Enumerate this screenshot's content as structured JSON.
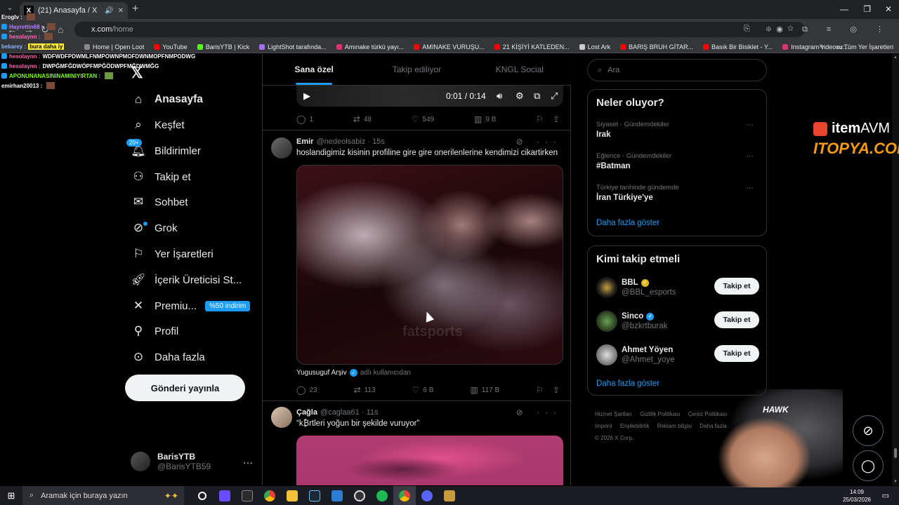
{
  "browser": {
    "tab_title": "(21) Anasayfa / X",
    "url_host": "x.com",
    "url_path": "/home",
    "bookmarks": [
      {
        "label": "Home | Open Loot",
        "color": "#8a8a8a"
      },
      {
        "label": "YouTube",
        "color": "#ff0000"
      },
      {
        "label": "BarisYTB | Kick",
        "color": "#53fc18"
      },
      {
        "label": "LightShot tarafında...",
        "color": "#a46cf0"
      },
      {
        "label": "Amınake türkü yayı...",
        "color": "#e1306c"
      },
      {
        "label": "AMINAKE VURUŞU...",
        "color": "#ff0000"
      },
      {
        "label": "21 KİŞİYİ KATLEDEN...",
        "color": "#ff0000"
      },
      {
        "label": "Lost Ark",
        "color": "#cccccc"
      },
      {
        "label": "BARIŞ BRUH GİTAR...",
        "color": "#ff0000"
      },
      {
        "label": "Basık Bir Bisiklet - Y...",
        "color": "#ff0000"
      },
      {
        "label": "Instagram videosu:...",
        "color": "#e1306c"
      }
    ],
    "bookmarks_more": "»",
    "all_bookmarks": "Tüm Yer İşaretleri"
  },
  "nav": {
    "items": [
      {
        "label": "Anasayfa",
        "icon": "home-icon"
      },
      {
        "label": "Keşfet",
        "icon": "search-icon"
      },
      {
        "label": "Bildirimler",
        "icon": "bell-icon",
        "badge": "20+"
      },
      {
        "label": "Takip et",
        "icon": "person-plus-icon"
      },
      {
        "label": "Sohbet",
        "icon": "mail-icon"
      },
      {
        "label": "Grok",
        "icon": "grok-icon"
      },
      {
        "label": "Yer İşaretleri",
        "icon": "bookmark-icon"
      },
      {
        "label": "İçerik Üreticisi St...",
        "icon": "rocket-icon"
      },
      {
        "label": "Premiu...",
        "icon": "x-icon",
        "badge": "%50 indirim"
      },
      {
        "label": "Profil",
        "icon": "person-icon"
      },
      {
        "label": "Daha fazla",
        "icon": "more-circle-icon"
      }
    ],
    "post_button": "Gönderi yayınla",
    "account": {
      "name": "BarisYTB",
      "handle": "@BarisYTB59"
    }
  },
  "feed": {
    "tabs": [
      "Sana özel",
      "Takip ediliyor",
      "KNGL Social"
    ],
    "video_time": "0:01 / 0:14",
    "first_actions": {
      "replies": "1",
      "reposts": "48",
      "likes": "549",
      "views": "9 B"
    },
    "tweet1": {
      "name": "Emir",
      "handle": "@nedeolsabiz",
      "time": "15s",
      "text": "hoslandigimiz kisinin profiline gire gire onerilenlerine kendimizi cikartirken",
      "watermark": "fatsports",
      "source": "Yugusuguf Arşiv",
      "source_suffix": "adlı kullanıcıdan",
      "replies": "23",
      "reposts": "113",
      "likes": "6 B",
      "views": "117 B"
    },
    "tweet2": {
      "name": "Çağla",
      "handle": "@caglaa61",
      "time": "11s",
      "text": "“k₿rtleri yoğun bir şekilde vuruyor”"
    }
  },
  "sidebar": {
    "search_placeholder": "Ara",
    "trends_title": "Neler oluyor?",
    "trends": [
      {
        "context": "Siyaset · Gündemdekiler",
        "title": "Irak"
      },
      {
        "context": "Eğlence · Gündemdekiler",
        "title": "#Batman"
      },
      {
        "context": "Türkiye tarihinde gündemde",
        "title": "İran Türkiye'ye"
      }
    ],
    "show_more": "Daha fazla göster",
    "who_title": "Kimi takip etmeli",
    "who": [
      {
        "name": "BBL",
        "handle": "@BBL_esports",
        "verified": "gold"
      },
      {
        "name": "Sinco",
        "handle": "@bzkrtburak",
        "verified": "blue"
      },
      {
        "name": "Ahmet Yöyen",
        "handle": "@Ahmet_yoye",
        "verified": ""
      }
    ],
    "follow_label": "Takip et",
    "who_more": "Daha fazla göster",
    "footer": [
      "Hizmet Şartları",
      "Gizlilik Politikası",
      "Çerez Politikası",
      "Imprint",
      "Erişilebilirlik",
      "Reklam bilgisi",
      "Daha fazla"
    ],
    "copyright": "© 2026 X Corp."
  },
  "overlay": {
    "chat": [
      {
        "user": "Eroglv :",
        "msg": ""
      },
      {
        "user": "Hayrettin68 :",
        "msg": ""
      },
      {
        "user": "hesolaynn :",
        "msg": ""
      },
      {
        "user": "bekarey :",
        "msg": "bura daha iy"
      },
      {
        "user": "hesolaynn :",
        "msg": "WDFWDFPDWMLFNMPOWNPMOFDWNMOPFNMPODWG"
      },
      {
        "user": "hesolaynn :",
        "msg": "DWPĞMFĞDWÖPFMPĞÖDWPFMĞDWMĞG"
      },
      {
        "user": "APONUNANASININAMINIYIRTAN :",
        "msg": ""
      },
      {
        "user": "emirhan20013 :",
        "msg": ""
      }
    ],
    "sponsor1": "item",
    "sponsor1b": "AVM",
    "sponsor2": "ITOPYA.COM",
    "webcam_brand": "HAWK"
  },
  "taskbar": {
    "search_placeholder": "Aramak için buraya yazın",
    "time": "14:09",
    "date": "25/03/2026"
  }
}
